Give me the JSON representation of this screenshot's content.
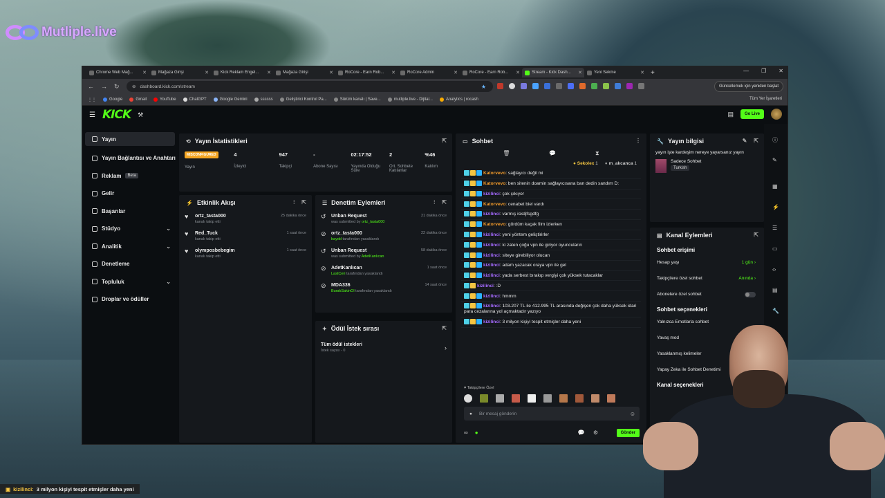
{
  "overlay": {
    "logo_text": "Mutliple.live",
    "ticker_user": "kizilinci:",
    "ticker_msg": "3 milyon kişiyi tespit etmişler daha yeni"
  },
  "browser": {
    "tabs": [
      {
        "label": "Chrome Web Mağ..."
      },
      {
        "label": "Mağaza Girişi"
      },
      {
        "label": "Kick Reklam Engel..."
      },
      {
        "label": "Mağaza Girişi"
      },
      {
        "label": "RoCore - Earn Rob..."
      },
      {
        "label": "RoCore Admin"
      },
      {
        "label": "RoCore - Earn Rob..."
      },
      {
        "label": "Stream - Kick Dash..."
      },
      {
        "label": "Yeni Sekme"
      }
    ],
    "url": "dashboard.kick.com/stream",
    "update_label": "Güncellemek için yeniden başlat",
    "bookmarks": [
      "Google",
      "Gmail",
      "YouTube",
      "ChatGPT",
      "Google Gemini",
      "ssssss",
      "Geliştirici Kontrol Pa...",
      "Sürüm kanalı | Save...",
      "mutliple.live - Dijital...",
      "Analytics | rocash"
    ],
    "bookmarks_right": "Tüm Yer İşaretleri"
  },
  "app": {
    "logo": "KICK",
    "go_live": "Go Live"
  },
  "sidebar": {
    "items": [
      {
        "label": "Yayın"
      },
      {
        "label": "Yayın Bağlantısı ve Anahtarı"
      },
      {
        "label": "Reklam",
        "badge": "Beta"
      },
      {
        "label": "Gelir"
      },
      {
        "label": "Başarılar"
      },
      {
        "label": "Stüdyo"
      },
      {
        "label": "Analitik"
      },
      {
        "label": "Denetleme"
      },
      {
        "label": "Topluluk"
      },
      {
        "label": "Droplar ve ödüller"
      }
    ]
  },
  "stats_panel": {
    "title": "Yayın İstatistikleri",
    "badge": "MISCONFIGURED",
    "stats": [
      {
        "value": "4",
        "label": "İzleyici"
      },
      {
        "value": "947",
        "label": "Takipçi"
      },
      {
        "value": "-",
        "label": "Abone Sayısı"
      },
      {
        "value": "02:17:52",
        "label": "Yayında Olduğu Süre"
      },
      {
        "value": "2",
        "label": "Ort. Sohbete Katılanlar"
      },
      {
        "value": "%46",
        "label": "Katılım"
      }
    ],
    "yayin_label": "Yayın"
  },
  "activity": {
    "title": "Etkinlik Akışı",
    "items": [
      {
        "name": "ortz_tasta000",
        "sub": "kanalı takip etti",
        "time": "25 dakika önce"
      },
      {
        "name": "Red_Tuck",
        "sub": "kanalı takip etti",
        "time": "1 saat önce"
      },
      {
        "name": "olymposbebegim",
        "sub": "kanalı takip etti",
        "time": "1 saat önce"
      }
    ]
  },
  "moderation": {
    "title": "Denetim Eylemleri",
    "items": [
      {
        "name": "Unban Request",
        "sub_pre": "was submitted by ",
        "sub_user": "ortz_tasta000",
        "sub_post": "",
        "time": "21 dakika önce"
      },
      {
        "name": "ortz_tasta000",
        "sub_pre": "",
        "sub_user": "baydd",
        "sub_post": " tarafından yasaklandı",
        "time": "22 dakika önce"
      },
      {
        "name": "Unban Request",
        "sub_pre": "was submitted by ",
        "sub_user": "AdetKanlıcan",
        "sub_post": "",
        "time": "58 dakika önce"
      },
      {
        "name": "AdetKanlıcan",
        "sub_pre": "",
        "sub_user": "LastCeri",
        "sub_post": " tarafından yasaklandı",
        "time": "1 saat önce"
      },
      {
        "name": "MDA336",
        "sub_pre": "",
        "sub_user": "BurakSakinOl",
        "sub_post": " tarafından yasaklandı",
        "time": "14 saat önce"
      }
    ]
  },
  "rewards": {
    "title": "Ödül İstek sırası",
    "item": "Tüm ödül istekleri",
    "sub": "İstek sayısı - 0"
  },
  "chat": {
    "title": "Sohbet",
    "pinned": [
      {
        "name": "Sekolex",
        "count": "1"
      },
      {
        "name": "m_akcanca",
        "count": "1"
      }
    ],
    "messages": [
      {
        "user": "Katorvevo",
        "type": "k",
        "text": "sağlayıcı değil mi"
      },
      {
        "user": "Katorvevo",
        "type": "k",
        "text": "ben sitenin doamin sağlayıcısana ban dedin sandım D:"
      },
      {
        "user": "kizilinci",
        "type": "z",
        "text": "çok çıkıyor"
      },
      {
        "user": "Katorvevo",
        "type": "k",
        "text": "cenabet biel vardı"
      },
      {
        "user": "kizilinci",
        "type": "z",
        "text": "varmış iskdjfsgdfg"
      },
      {
        "user": "Katorvevo",
        "type": "k",
        "text": "gördüm kaçak film izlerken"
      },
      {
        "user": "kizilinci",
        "type": "z",
        "text": "yeni yöntem geliştirirler"
      },
      {
        "user": "kizilinci",
        "type": "z",
        "text": "ki zaten çoğu vpn ile giriyor oyuncuların"
      },
      {
        "user": "kizilinci",
        "type": "z",
        "text": "siteye girebiliyor olucan"
      },
      {
        "user": "kizilinci",
        "type": "z",
        "text": "adam yazacak oraya vpn ile gel"
      },
      {
        "user": "kizilinci",
        "type": "z",
        "text": "yada serbest bırakıp vergiyi çok yüksek tutacaklar"
      },
      {
        "user": "kizilinci",
        "type": "z",
        "text": ":D"
      },
      {
        "user": "kizilinci",
        "type": "z",
        "text": "hmmm"
      },
      {
        "user": "kizilinci",
        "type": "z",
        "text": "103.207 TL ile 412.995 TL arasında değişen çok daha yüksek idari para cezalarına yol açmaktadır yazıyo"
      },
      {
        "user": "kizilinci",
        "type": "z",
        "text": "3 milyon kişiyi tespit etmişler daha yeni"
      }
    ],
    "followers_only": "Takipçilere Özel",
    "placeholder": "Bir mesaj gönderin",
    "send_label": "Gönder"
  },
  "stream_info": {
    "title": "Yayın bilgisi",
    "description": "yayın işte kardeşim nereye yayarsanız yayın",
    "category": "Sadece Sohbet",
    "language": "Turkish"
  },
  "channel_actions": {
    "title": "Kanal Eylemleri",
    "chat_access": "Sohbet erişimi",
    "rows1": [
      {
        "label": "Hesap yaşı",
        "value": "1 gün"
      },
      {
        "label": "Takipçilere özel sohbet",
        "value": "Anında"
      },
      {
        "label": "Abonelere özel sohbet",
        "value": ""
      }
    ],
    "chat_options": "Sohbet seçenekleri",
    "rows2": [
      {
        "label": "Yalnızca Emotlarla sohbet"
      },
      {
        "label": "Yavaş mod"
      },
      {
        "label": "Yasaklanmış kelimeler"
      },
      {
        "label": "Yapay Zeka ile Sohbet Denetimi"
      }
    ],
    "channel_options": "Kanal seçenekleri"
  }
}
